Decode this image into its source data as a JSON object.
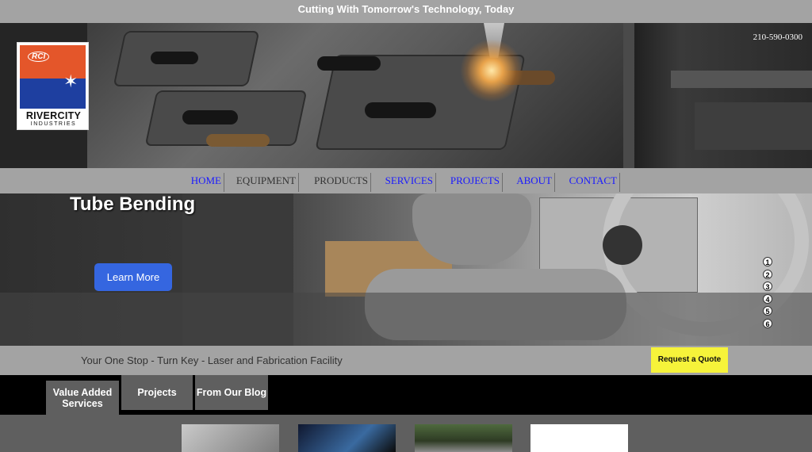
{
  "topbar": {
    "slogan": "Cutting With Tomorrow's Technology, Today"
  },
  "header": {
    "phone": "210-590-0300",
    "logo": {
      "name": "RIVERCITY",
      "sub": "INDUSTRIES",
      "mark": "RCI"
    }
  },
  "nav": {
    "items": [
      {
        "label": "HOME"
      },
      {
        "label": "EQUIPMENT"
      },
      {
        "label": "PRODUCTS"
      },
      {
        "label": "SERVICES"
      },
      {
        "label": "PROJECTS"
      },
      {
        "label": "ABOUT"
      },
      {
        "label": "CONTACT"
      }
    ]
  },
  "hero": {
    "title": "Tube Bending",
    "button": "Learn More",
    "slides": [
      "1",
      "2",
      "3",
      "4",
      "5",
      "6"
    ]
  },
  "tagline": {
    "text": "Your One Stop - Turn Key - Laser and Fabrication Facility",
    "quote_button": "Request a Quote"
  },
  "tabs": [
    {
      "label": "Value Added Services"
    },
    {
      "label": "Projects"
    },
    {
      "label": "From Our Blog"
    }
  ],
  "colors": {
    "accent_blue": "#3566e0",
    "quote_yellow": "#f6f33a",
    "nav_link": "#1a1aff"
  }
}
